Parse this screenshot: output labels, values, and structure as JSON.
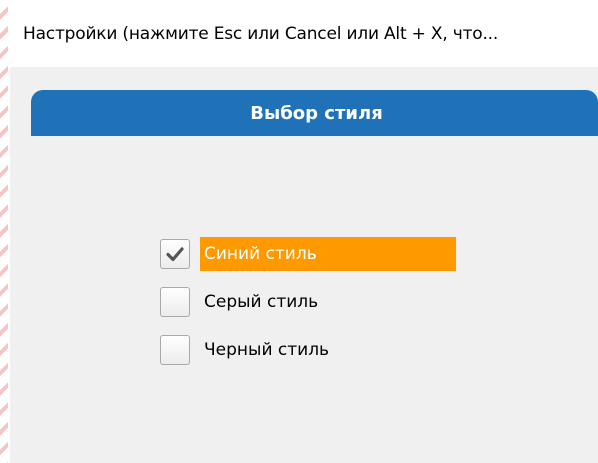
{
  "window": {
    "title": "Настройки (нажмите Esc или Cancel или Alt + X, что..."
  },
  "panel": {
    "title": "Выбор стиля",
    "accent_color": "#1f72b8"
  },
  "styles": {
    "selected_color": "#ff9900",
    "options": [
      {
        "label": "Синий стиль",
        "checked": true
      },
      {
        "label": "Серый стиль",
        "checked": false
      },
      {
        "label": "Черный стиль",
        "checked": false
      }
    ]
  },
  "icons": {
    "check": "check-icon"
  }
}
